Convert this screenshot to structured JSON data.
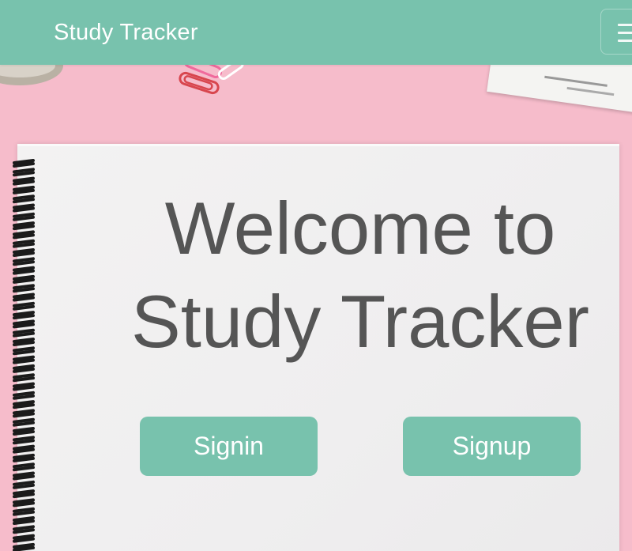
{
  "colors": {
    "accent": "#78c2ad",
    "background": "#f6bccb",
    "paper": "#f1f0f0",
    "heading_text": "#555555",
    "button_text": "#ffffff"
  },
  "navbar": {
    "brand": "Study Tracker",
    "menu_icon": "hamburger-menu-icon"
  },
  "hero": {
    "title_line1": "Welcome to",
    "title_line2": "Study Tracker"
  },
  "actions": {
    "signin_label": "Signin",
    "signup_label": "Signup"
  }
}
